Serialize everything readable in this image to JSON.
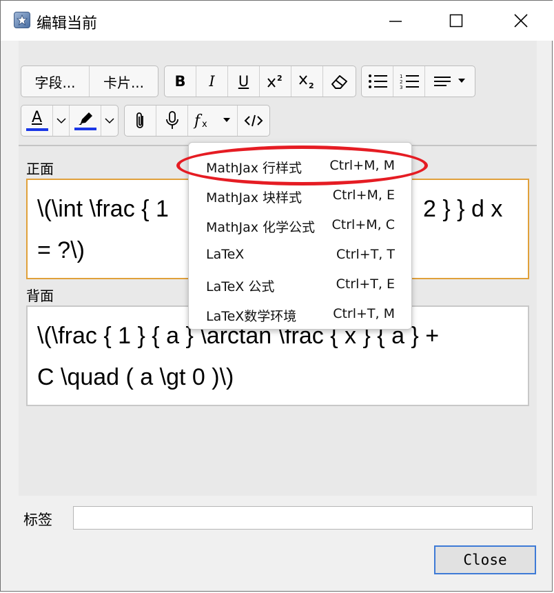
{
  "window": {
    "title": "编辑当前",
    "controls": [
      "minimize",
      "maximize",
      "close"
    ]
  },
  "toolbar": {
    "fields_label": "字段...",
    "cards_label": "卡片...",
    "bold": "B",
    "italic": "I",
    "underline": "U",
    "text_color": "A",
    "color_accent": "#1a37e6"
  },
  "fields": {
    "front_label": "正面",
    "front_value_line1": "\\(\\int \\frac { 1",
    "front_value_line1_end": "2 } } d x",
    "front_value_line2": "= ?\\)",
    "back_label": "背面",
    "back_value_line1": "\\(\\frac { 1 } { a } \\arctan \\frac { x } { a } +",
    "back_value_line2": "C \\quad ( a \\gt 0 )\\)"
  },
  "tags": {
    "label": "标签",
    "value": ""
  },
  "close_button": "Close",
  "latex_menu": {
    "items": [
      {
        "label": "MathJax 行样式",
        "shortcut": "Ctrl+M, M"
      },
      {
        "label": "MathJax 块样式",
        "shortcut": "Ctrl+M, E"
      },
      {
        "label": "MathJax 化学公式",
        "shortcut": "Ctrl+M, C"
      },
      {
        "label": "LaTeX",
        "shortcut": "Ctrl+T, T"
      },
      {
        "label": "LaTeX 公式",
        "shortcut": "Ctrl+T, E"
      },
      {
        "label": "LaTeX数学环境",
        "shortcut": "Ctrl+T, M"
      }
    ]
  }
}
